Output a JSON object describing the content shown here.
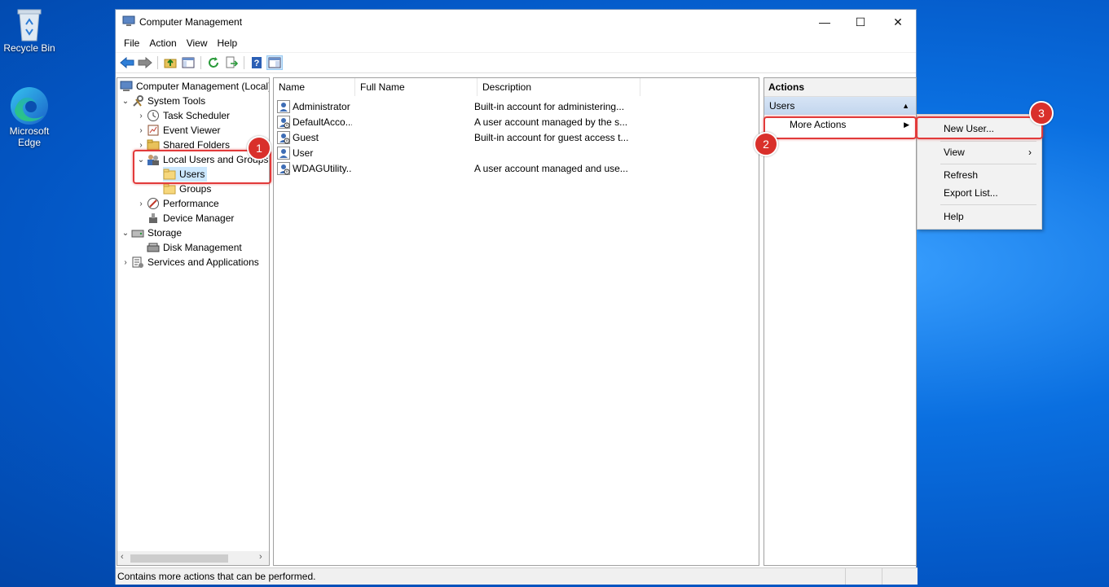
{
  "desktop": {
    "icons": [
      {
        "label": "Recycle Bin",
        "icon": "recycle-bin-icon"
      },
      {
        "label": "Microsoft Edge",
        "icon": "edge-icon"
      }
    ]
  },
  "window": {
    "title": "Computer Management",
    "controls": {
      "minimize": "—",
      "maximize": "☐",
      "close": "✕"
    },
    "menu": [
      "File",
      "Action",
      "View",
      "Help"
    ],
    "toolbar_icons": [
      "back-arrow-icon",
      "forward-arrow-icon",
      "up-folder-icon",
      "show-hide-tree-icon",
      "refresh-icon",
      "export-list-icon",
      "help-icon",
      "properties-icon"
    ]
  },
  "tree": {
    "root": "Computer Management (Local)",
    "system_tools": "System Tools",
    "task_scheduler": "Task Scheduler",
    "event_viewer": "Event Viewer",
    "shared_folders": "Shared Folders",
    "local_users_groups": "Local Users and Groups",
    "users": "Users",
    "groups": "Groups",
    "performance": "Performance",
    "device_manager": "Device Manager",
    "storage": "Storage",
    "disk_management": "Disk Management",
    "services_apps": "Services and Applications"
  },
  "list": {
    "columns": [
      "Name",
      "Full Name",
      "Description"
    ],
    "rows": [
      {
        "name": "Administrator",
        "full_name": "",
        "description": "Built-in account for administering..."
      },
      {
        "name": "DefaultAcco...",
        "full_name": "",
        "description": "A user account managed by the s..."
      },
      {
        "name": "Guest",
        "full_name": "",
        "description": "Built-in account for guest access t..."
      },
      {
        "name": "User",
        "full_name": "",
        "description": ""
      },
      {
        "name": "WDAGUtility...",
        "full_name": "",
        "description": "A user account managed and use..."
      }
    ]
  },
  "actions": {
    "header": "Actions",
    "section": "Users",
    "more_actions": "More Actions"
  },
  "context_menu": {
    "new_user": "New User...",
    "view": "View",
    "refresh": "Refresh",
    "export_list": "Export List...",
    "help": "Help"
  },
  "status_bar": "Contains more actions that can be performed.",
  "annotations": {
    "step1": "1",
    "step2": "2",
    "step3": "3"
  },
  "colors": {
    "highlight": "#e23a3a",
    "selected": "#cce8ff",
    "accent": "#0a6fe0"
  }
}
